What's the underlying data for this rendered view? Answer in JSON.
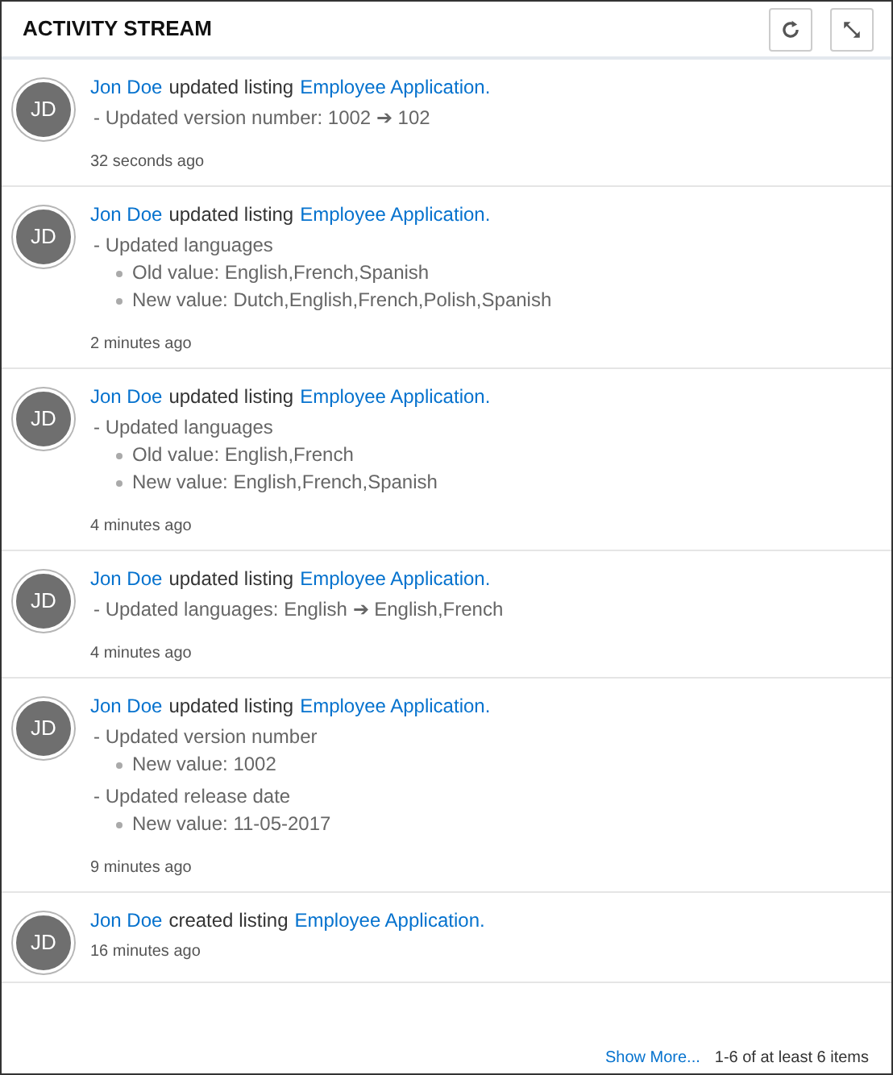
{
  "header": {
    "title": "ACTIVITY STREAM"
  },
  "entries": [
    {
      "user": "Jon Doe",
      "action": "updated listing",
      "target": "Employee Application.",
      "avatar": "JD",
      "changes": [
        {
          "text": "- Updated version number: 1002 ➔ 102"
        }
      ],
      "time": "32 seconds ago"
    },
    {
      "user": "Jon Doe",
      "action": "updated listing",
      "target": "Employee Application.",
      "avatar": "JD",
      "changes": [
        {
          "text": "- Updated languages",
          "items": [
            "Old value: English,French,Spanish",
            "New value: Dutch,English,French,Polish,Spanish"
          ]
        }
      ],
      "time": "2 minutes ago"
    },
    {
      "user": "Jon Doe",
      "action": "updated listing",
      "target": "Employee Application.",
      "avatar": "JD",
      "changes": [
        {
          "text": "- Updated languages",
          "items": [
            "Old value: English,French",
            "New value: English,French,Spanish"
          ]
        }
      ],
      "time": "4 minutes ago"
    },
    {
      "user": "Jon Doe",
      "action": "updated listing",
      "target": "Employee Application.",
      "avatar": "JD",
      "changes": [
        {
          "text": "- Updated languages: English ➔ English,French"
        }
      ],
      "time": "4 minutes ago"
    },
    {
      "user": "Jon Doe",
      "action": "updated listing",
      "target": "Employee Application.",
      "avatar": "JD",
      "changes": [
        {
          "text": "- Updated version number",
          "items": [
            "New value: 1002"
          ]
        },
        {
          "text": "- Updated release date",
          "items": [
            "New value: 11-05-2017"
          ]
        }
      ],
      "time": "9 minutes ago"
    },
    {
      "user": "Jon Doe",
      "action": "created listing",
      "target": "Employee Application.",
      "avatar": "JD",
      "time": "16 minutes ago"
    }
  ],
  "footer": {
    "link": "Show More...",
    "count": "1-6 of at least 6 items"
  }
}
